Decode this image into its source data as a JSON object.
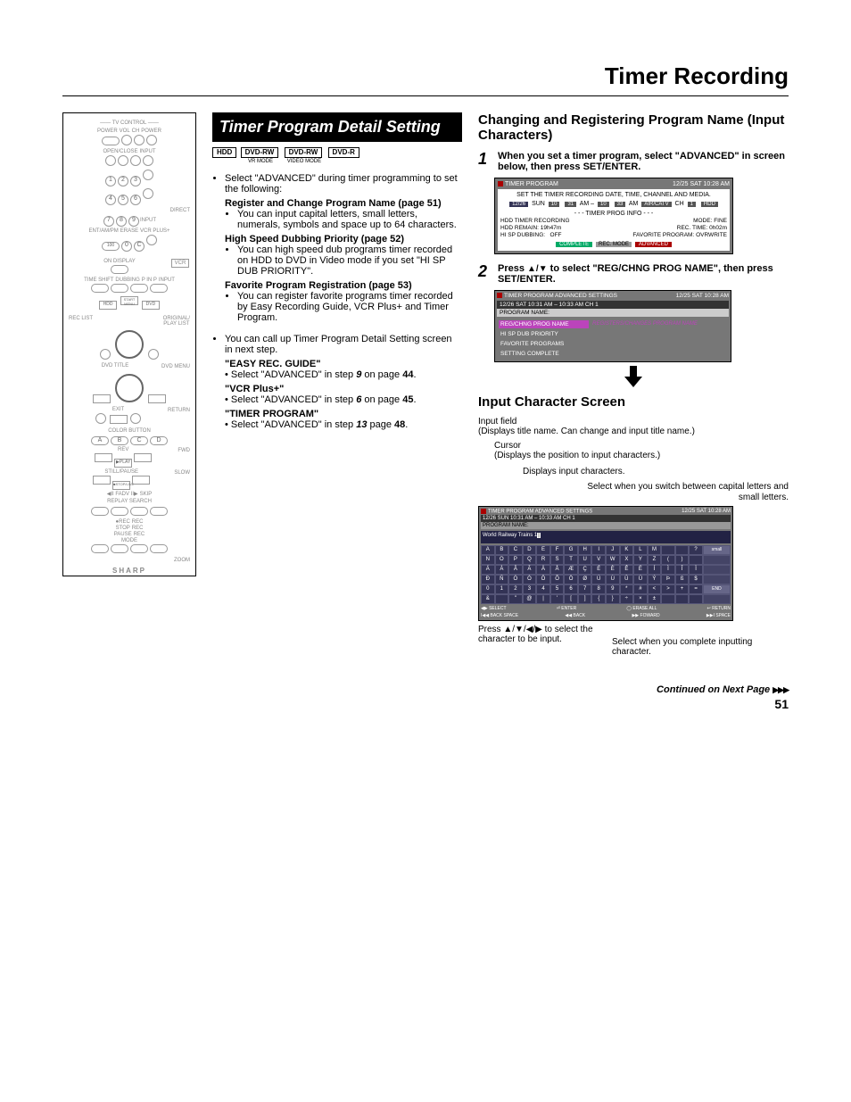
{
  "page": {
    "title": "Timer Recording",
    "number": "51",
    "continued": "Continued on Next Page"
  },
  "remote": {
    "header": "TV CONTROL",
    "labels": {
      "power": "POWER",
      "vol": "VOL",
      "ch": "CH",
      "power2": "POWER",
      "openclose": "OPEN/CLOSE",
      "input": "INPUT",
      "direct": "DIRECT",
      "ent": "ENT/AM/PM",
      "erase": "ERASE",
      "vcrplus": "VCR PLUS+",
      "n100": "100",
      "n0": "0",
      "c": "C",
      "ondisplay": "ON DISPLAY",
      "vcr": "VCR",
      "timeshift": "TIME SHIFT",
      "dubbing": "DUBBING",
      "pinp": "P IN P",
      "input2": "INPUT",
      "hdd": "HDD",
      "startmenu": "START MENU",
      "dvd": "DVD",
      "reclist": "REC LIST",
      "origplay": "ORIGINAL/\nPLAY LIST",
      "dvdtitle": "DVD TITLE",
      "dvdmenu": "DVD MENU",
      "exit": "EXIT",
      "return": "RETURN",
      "colora": "A",
      "colorb": "B",
      "colorc": "C",
      "colord": "D",
      "rev": "REV",
      "fwd": "FWD",
      "play": "▶PLAY",
      "stillpause": "STILL/PAUSE",
      "stoplive": "■STOP/LIVE",
      "slow": "SLOW",
      "fadv": "◀II FADV II▶",
      "skip": "SKIP",
      "replay": "REPLAY",
      "search": "SEARCH",
      "rec": "●REC",
      "recstop": "REC\nSTOP",
      "recpause": "REC\nPAUSE",
      "recmode": "REC\nMODE",
      "zoom": "ZOOM",
      "brand": "SHARP",
      "n1": "1",
      "n2": "2",
      "n3": "3",
      "n4": "4",
      "n5": "5",
      "n6": "6",
      "n7": "7",
      "n8": "8",
      "n9": "9"
    }
  },
  "center": {
    "heading": "Timer Program Detail Setting",
    "tags": {
      "hdd": "HDD",
      "dvdrw1": "DVD-RW",
      "dvdrw1_sub": "VR MODE",
      "dvdrw2": "DVD-RW",
      "dvdrw2_sub": "VIDEO MODE",
      "dvdr": "DVD-R"
    },
    "bullet1": "Select \"ADVANCED\" during timer programming to set the following:",
    "reg_head": "Register and Change Program Name (page 51)",
    "reg_txt": "You can input capital letters, small letters, numerals, symbols and space up to 64 characters.",
    "hsd_head": "High Speed Dubbing Priority (page 52)",
    "hsd_txt": "You can high speed dub programs timer recorded on HDD to DVD in Video mode if you set \"HI SP DUB PRIORITY\".",
    "fav_head": "Favorite Program Registration (page 53)",
    "fav_txt": "You can register favorite programs timer recorded by Easy Recording Guide, VCR Plus+ and Timer Program.",
    "bullet2": "You can call up Timer Program Detail Setting screen in next step.",
    "easy_head": "\"EASY REC. GUIDE\"",
    "easy_txt_a": "Select \"ADVANCED\" in step ",
    "easy_step": "9",
    "easy_txt_b": " on page ",
    "easy_page": "44",
    "vcr_head": "\"VCR Plus+\"",
    "vcr_txt_a": "Select \"ADVANCED\" in step ",
    "vcr_step": "6",
    "vcr_txt_b": " on page ",
    "vcr_page": "45",
    "tp_head": "\"TIMER PROGRAM\"",
    "tp_txt_a": "Select \"ADVANCED\" in step ",
    "tp_step": "13",
    "tp_txt_b": " page ",
    "tp_page": "48"
  },
  "right": {
    "heading1": "Changing and Registering Program Name (Input Characters)",
    "step1": "When you set a timer program, select \"ADVANCED\" in screen below, then press ",
    "setenter": "SET/ENTER",
    "osd1": {
      "title": "TIMER PROGRAM",
      "clock": "12/25 SAT 10:28 AM",
      "instr": "SET THE TIMER RECORDING DATE, TIME, CHANNEL AND MEDIA.",
      "date": "12/26",
      "day": "SUN",
      "t1a": "10",
      "t1b": "31",
      "ampm1": "AM",
      "dash": "–",
      "t2a": "10",
      "t2b": "33",
      "ampm2": "AM",
      "src": "AIR/CATV",
      "chlbl": "CH",
      "ch": "1",
      "media": "HDD",
      "divider": "- - - TIMER PROG INFO - - -",
      "r1a": "HDD TIMER RECORDING",
      "r1b": "MODE:",
      "r1c": "FINE",
      "r2a": "HDD REMAIN: 19h47m",
      "r2b": "REC. TIME: 0h02m",
      "r3a": "HI SP DUBBING:",
      "r3b": "OFF",
      "r3c": "FAVORITE PROGRAM: OVRWRITE",
      "complete": "COMPLETE",
      "recmode": "REC. MODE",
      "advanced": "ADVANCED"
    },
    "step2a": "Press ",
    "step2arrows": "▲/▼",
    "step2b": " to select \"REG/CHNG PROG NAME\", then press ",
    "osd2": {
      "title": "TIMER PROGRAM ADVANCED SETTINGS",
      "clock": "12/25 SAT 10:28 AM",
      "sub": "12/26 SAT 10:31 AM – 10:33 AM CH 1",
      "pname": "PROGRAM NAME:",
      "row_sel": "REG/CHNG PROG NAME",
      "row_sel_side": "REGISTERS/CHANGES PROGRAM NAME",
      "row2": "HI SP DUB PRIORITY",
      "row3": "FAVORITE PROGRAMS",
      "row4": "SETTING COMPLETE"
    },
    "heading2": "Input Character Screen",
    "cs": {
      "input_field": "Input field",
      "input_field_sub": "(Displays title name. Can change and input title name.)",
      "cursor": "Cursor",
      "cursor_sub": "(Displays the position to input characters.)",
      "disp_chars": "Displays input characters.",
      "switch_caps": "Select when you switch between capital letters and small letters.",
      "press_arrows_a": "Press ",
      "press_arrows_sym": "▲/▼/◀/▶",
      "press_arrows_b": " to select the character to be input.",
      "end_txt": "Select when you complete inputting character."
    },
    "osd3": {
      "title": "TIMER PROGRAM ADVANCED SETTINGS",
      "clock": "12/25 SAT 10:28 AM",
      "sub": "12/26 SUN  10:31 AM – 10:33 AM  CH 1",
      "pname_lbl": "PROGRAM NAME:",
      "sample": "World Railway Trains 1",
      "small_btn": "small",
      "end_btn": "END",
      "foot_select_sym": "◀▶",
      "foot_select": "SELECT",
      "foot_enter_sym": "⏎",
      "foot_enter": "ENTER",
      "foot_eraseall_sym": "◯",
      "foot_eraseall": "ERASE ALL",
      "foot_return_sym": "↩",
      "foot_return": "RETURN",
      "foot_back_sym": "I◀◀",
      "foot_back": "BACK SPACE",
      "foot_bwd_sym": "◀◀",
      "foot_bwd": "BACK",
      "foot_fwd_sym": "▶▶",
      "foot_fwd": "FOWARD",
      "foot_space_sym": "▶▶I",
      "foot_space": "SPACE"
    }
  },
  "chart_data": {
    "type": "table",
    "title": "Input Character Screen grid contents",
    "rows": [
      [
        "A",
        "B",
        "C",
        "D",
        "E",
        "F",
        "G",
        "H",
        "I",
        "J",
        "K",
        "L",
        "M",
        "",
        "",
        "?",
        "!",
        ""
      ],
      [
        "N",
        "O",
        "P",
        "Q",
        "R",
        "S",
        "T",
        "U",
        "V",
        "W",
        "X",
        "Y",
        "Z",
        "(",
        ")",
        "",
        "",
        ""
      ],
      [
        "Á",
        "À",
        "Â",
        "Ã",
        "Ä",
        "Å",
        "Æ",
        "Ç",
        "É",
        "È",
        "Ê",
        "Ë",
        "Í",
        "Ì",
        "Î",
        "Ï",
        "",
        "/"
      ],
      [
        "Ð",
        "Ñ",
        "Ó",
        "Ò",
        "Ô",
        "Õ",
        "Ö",
        "Ø",
        "Ú",
        "Ù",
        "Û",
        "Ü",
        "Ý",
        "Þ",
        "ß",
        "$",
        "%",
        ""
      ],
      [
        "0",
        "1",
        "2",
        "3",
        "4",
        "5",
        "6",
        "7",
        "8",
        "9",
        "*",
        "#",
        "<",
        ">",
        "+",
        "=",
        "",
        ""
      ],
      [
        "&",
        "",
        "\"",
        "@",
        "|",
        "'",
        "[",
        "]",
        "{",
        "}",
        "÷",
        "×",
        "±",
        "",
        "",
        "",
        "",
        ""
      ]
    ],
    "side_buttons_right": [
      "small",
      "",
      "",
      "",
      "END",
      ""
    ]
  }
}
